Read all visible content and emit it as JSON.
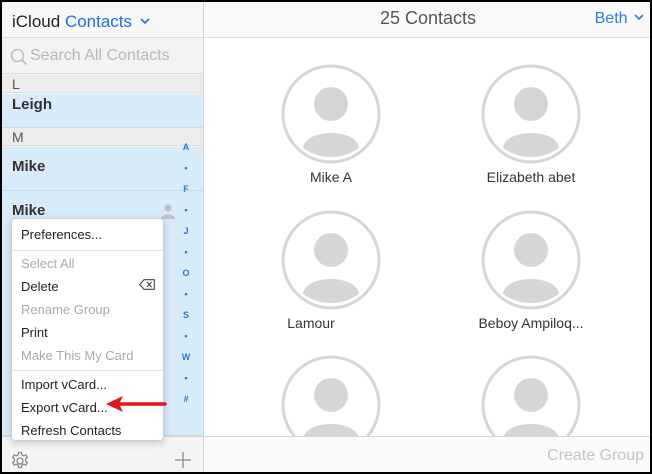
{
  "header": {
    "app_name": "iCloud",
    "section": "Contacts",
    "contact_count": "25 Contacts",
    "user": "Beth"
  },
  "search": {
    "placeholder": "Search All Contacts"
  },
  "list": {
    "sections": [
      {
        "letter": "L",
        "contacts": [
          "Leigh"
        ]
      },
      {
        "letter": "M",
        "contacts": [
          "Mike",
          "Mike"
        ]
      }
    ]
  },
  "alpha_index": [
    "A",
    "•",
    "F",
    "•",
    "J",
    "•",
    "O",
    "•",
    "S",
    "•",
    "W",
    "•",
    "#"
  ],
  "menu": {
    "items": [
      {
        "label": "Preferences...",
        "enabled": true
      },
      {
        "label": "Select All",
        "enabled": false
      },
      {
        "label": "Delete",
        "enabled": true
      },
      {
        "label": "Rename Group",
        "enabled": false
      },
      {
        "label": "Print",
        "enabled": true
      },
      {
        "label": "Make This My Card",
        "enabled": false
      },
      {
        "label": "Import vCard...",
        "enabled": true
      },
      {
        "label": "Export vCard...",
        "enabled": true
      },
      {
        "label": "Refresh Contacts",
        "enabled": true
      }
    ]
  },
  "cards": [
    {
      "name": "Mike A"
    },
    {
      "name": "Elizabeth abet"
    },
    {
      "name": "Lamour"
    },
    {
      "name": "Beboy Ampiloq..."
    },
    {
      "name": ""
    },
    {
      "name": ""
    }
  ],
  "footer": {
    "create_group": "Create Group"
  },
  "colors": {
    "accent": "#1e6fd9",
    "selected_row": "#d8ebf9",
    "arrow": "#e0161c"
  }
}
